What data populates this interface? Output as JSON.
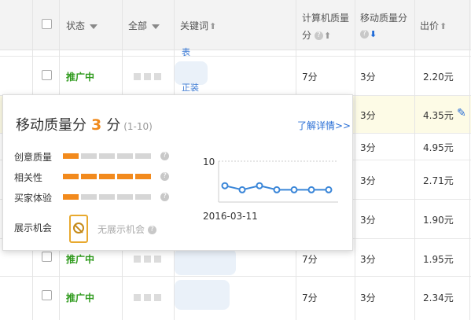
{
  "header": {
    "status": "状态",
    "all": "全部",
    "keyword": "关键词",
    "pc_quality_line1": "计算机质量",
    "pc_quality_line2": "分",
    "mobile_quality": "移动质量分",
    "bid": "出价"
  },
  "rows": [
    {
      "status": "",
      "pc": "",
      "mobile": "",
      "bid": "",
      "kw_frag": "表"
    },
    {
      "status": "推广中",
      "pc": "7分",
      "mobile": "3分",
      "bid": "2.20元",
      "kw_frag": "正装"
    },
    {
      "status": "",
      "pc": "",
      "mobile": "3分",
      "bid": "4.35元",
      "kw_frag": ""
    },
    {
      "status": "",
      "pc": "",
      "mobile": "3分",
      "bid": "4.95元",
      "kw_frag": ""
    },
    {
      "status": "",
      "pc": "",
      "mobile": "3分",
      "bid": "2.71元",
      "kw_frag": ""
    },
    {
      "status": "",
      "pc": "",
      "mobile": "3分",
      "bid": "1.90元",
      "kw_frag": ""
    },
    {
      "status": "推广中",
      "pc": "7分",
      "mobile": "3分",
      "bid": "1.95元",
      "kw_frag": ""
    },
    {
      "status": "推广中",
      "pc": "7分",
      "mobile": "3分",
      "bid": "2.34元",
      "kw_frag": ""
    }
  ],
  "popup": {
    "title": "移动质量分",
    "score": "3",
    "unit": "分",
    "range": "(1-10)",
    "link": "了解详情>>",
    "metrics": [
      {
        "label": "创意质量",
        "level": 1
      },
      {
        "label": "相关性",
        "level": 5
      },
      {
        "label": "买家体验",
        "level": 1
      }
    ],
    "exposure_label": "展示机会",
    "no_exposure": "无展示机会",
    "chart_y_label": "10",
    "chart_date": "2016-03-11"
  },
  "chart_data": {
    "type": "line",
    "ylim": [
      0,
      10
    ],
    "y_tick_labels": [
      "10"
    ],
    "x_label": "2016-03-11",
    "values": [
      4,
      3,
      4,
      3,
      3,
      3,
      3
    ]
  },
  "colors": {
    "accent_orange": "#f28a1d",
    "link_blue": "#2a6fd6",
    "status_green": "#2e9a1c"
  }
}
